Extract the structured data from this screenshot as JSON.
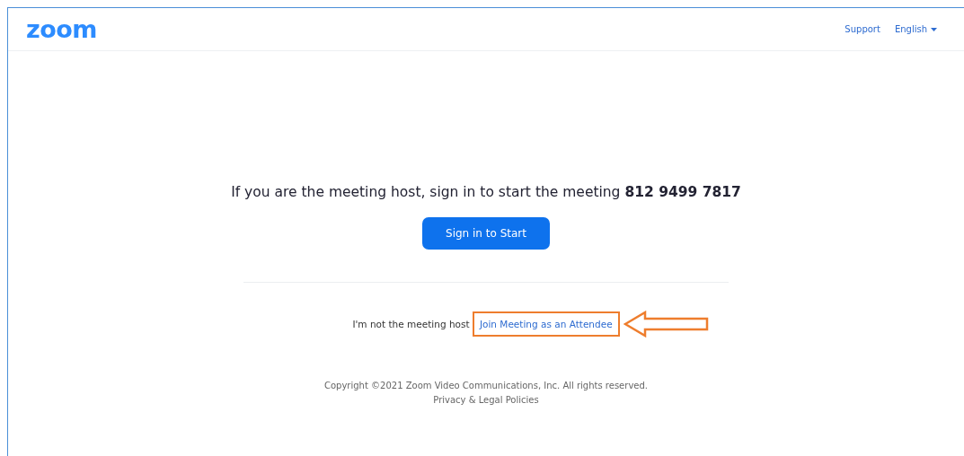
{
  "header": {
    "logo": "zoom",
    "links": [
      {
        "label": "Support",
        "kind": "link"
      },
      {
        "label": "English",
        "kind": "dropdown"
      }
    ]
  },
  "host_prompt": {
    "text": "If you are the meeting host, sign in to start the meeting ",
    "meeting_id": "812 9499 7817"
  },
  "sign_in_button": "Sign in to Start",
  "attendee": {
    "text": "I'm not the meeting host",
    "link": "Join Meeting as an Attendee",
    "highlighted": true
  },
  "footer": {
    "copyright": "Copyright ©2021 Zoom Video Communications, Inc. All rights reserved.",
    "policies_link": "Privacy & Legal Policies"
  }
}
